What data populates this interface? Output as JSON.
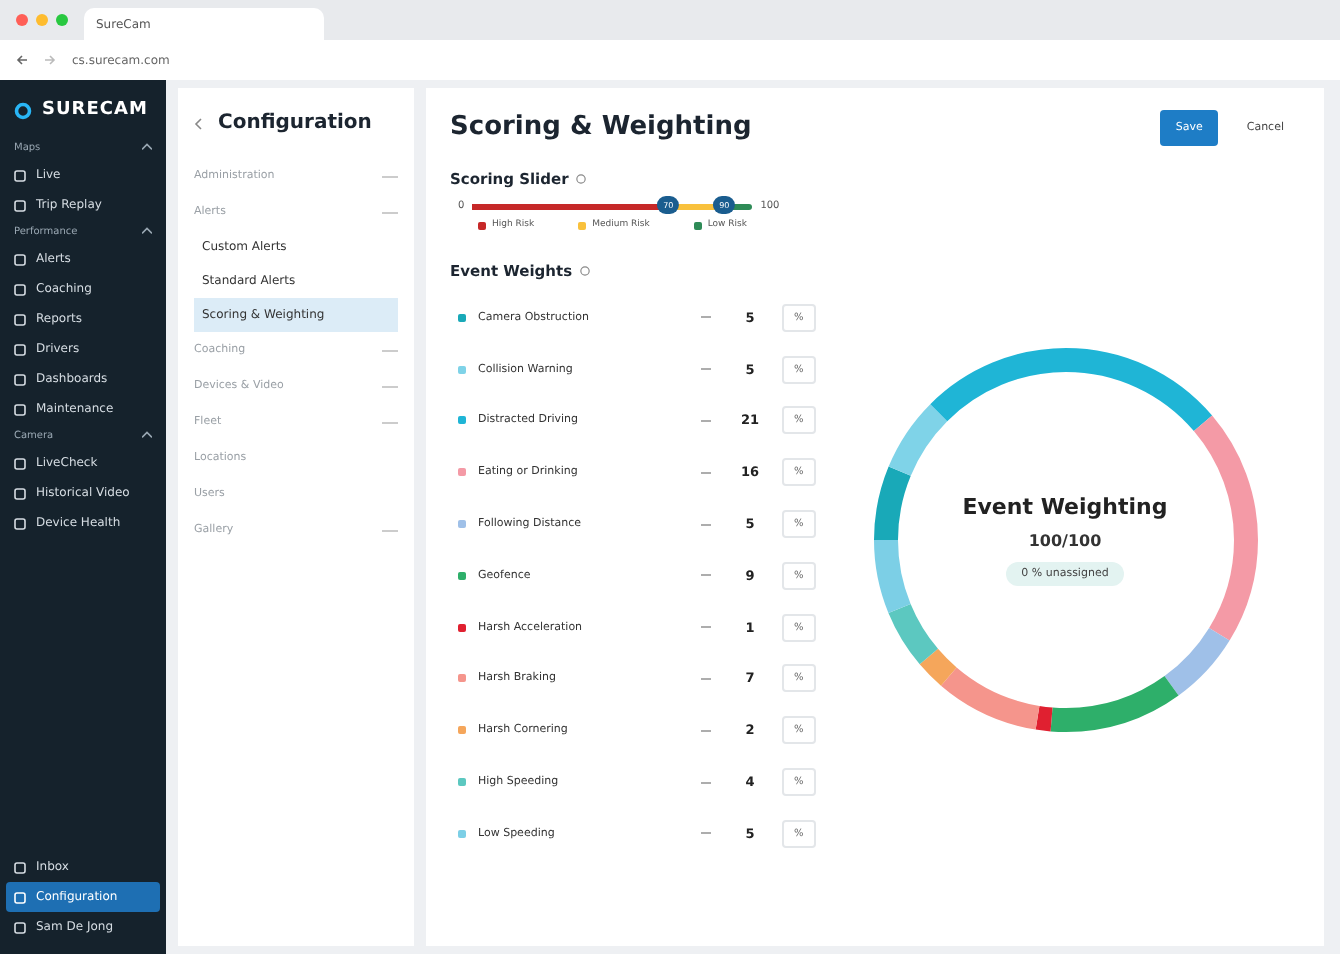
{
  "browser": {
    "tab_title": "SureCam",
    "url": "cs.surecam.com"
  },
  "sidebar": {
    "logo": "SURECAM",
    "sections": [
      {
        "title": "Maps",
        "items": [
          {
            "label": "Live",
            "selected": false
          },
          {
            "label": "Trip Replay",
            "selected": false
          }
        ]
      },
      {
        "title": "Performance",
        "items": [
          {
            "label": "Alerts",
            "selected": false
          },
          {
            "label": "Coaching",
            "selected": false
          },
          {
            "label": "Reports",
            "selected": false
          },
          {
            "label": "Drivers",
            "selected": false
          },
          {
            "label": "Dashboards",
            "selected": false
          },
          {
            "label": "Maintenance",
            "selected": false
          }
        ]
      },
      {
        "title": "Camera",
        "items": [
          {
            "label": "LiveCheck",
            "selected": false
          },
          {
            "label": "Historical Video",
            "selected": false
          },
          {
            "label": "Device Health",
            "selected": false
          }
        ]
      }
    ],
    "bottom_items": [
      {
        "label": "Inbox",
        "selected": false
      },
      {
        "label": "Configuration",
        "selected": true
      },
      {
        "label": "Sam De Jong",
        "selected": false
      }
    ]
  },
  "config_menu": {
    "title": "Configuration",
    "items": [
      {
        "label": "Administration",
        "collapsible": true
      },
      {
        "label": "Alerts",
        "collapsible": true,
        "children": [
          {
            "label": "Custom Alerts",
            "selected": false
          },
          {
            "label": "Standard Alerts",
            "selected": false
          },
          {
            "label": "Scoring & Weighting",
            "selected": true
          }
        ]
      },
      {
        "label": "Coaching",
        "collapsible": true
      },
      {
        "label": "Devices & Video",
        "collapsible": true
      },
      {
        "label": "Fleet",
        "collapsible": true
      },
      {
        "label": "Locations",
        "collapsible": false
      },
      {
        "label": "Users",
        "collapsible": false
      },
      {
        "label": "Gallery",
        "collapsible": true
      }
    ]
  },
  "page": {
    "title": "Scoring & Weighting",
    "buttons": [
      {
        "label": "Save",
        "kind": "primary"
      },
      {
        "label": "Cancel",
        "kind": "secondary"
      }
    ]
  },
  "scoring_slider": {
    "title": "Scoring Slider",
    "min": "0",
    "max": "100",
    "thumbs": [
      {
        "label": "70",
        "level": 0.7
      },
      {
        "label": "90",
        "level": 0.9
      }
    ],
    "legend": [
      {
        "label": "High Risk",
        "color": "#c62828"
      },
      {
        "label": "Medium Risk",
        "color": "#f9c13c"
      },
      {
        "label": "Low Risk",
        "color": "#2e8b57"
      }
    ]
  },
  "event_weights": {
    "title": "Event Weights",
    "unit": "%",
    "rows": [
      {
        "name": "Camera Obstruction",
        "value": "5",
        "color": "#19a9b8"
      },
      {
        "name": "Collision Warning",
        "value": "5",
        "color": "#7fd3e8"
      },
      {
        "name": "Distracted Driving",
        "value": "21",
        "color": "#1fb5d6"
      },
      {
        "name": "Eating or Drinking",
        "value": "16",
        "color": "#f49aa6"
      },
      {
        "name": "Following Distance",
        "value": "5",
        "color": "#9fc0e8"
      },
      {
        "name": "Geofence",
        "value": "9",
        "color": "#2eaf6a"
      },
      {
        "name": "Harsh Acceleration",
        "value": "1",
        "color": "#e02030"
      },
      {
        "name": "Harsh Braking",
        "value": "7",
        "color": "#f5958c"
      },
      {
        "name": "Harsh Cornering",
        "value": "2",
        "color": "#f5a65b"
      },
      {
        "name": "High Speeding",
        "value": "4",
        "color": "#5cc8c0"
      },
      {
        "name": "Low Speeding",
        "value": "5",
        "color": "#7ccfe6"
      }
    ]
  },
  "weighting_summary": {
    "title": "Event Weighting",
    "total": "100/100",
    "badge": "0 % unassigned"
  }
}
